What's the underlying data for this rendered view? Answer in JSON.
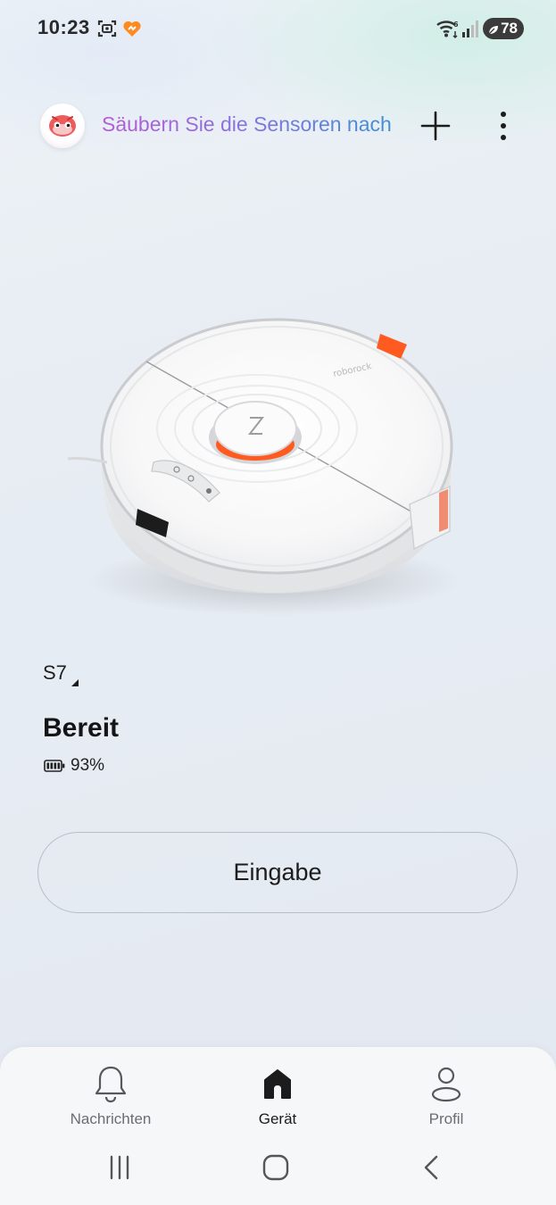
{
  "status_bar": {
    "time": "10:23",
    "battery": "78",
    "icons": [
      "screenshot-icon",
      "app-heart-icon",
      "wifi-icon",
      "signal-icon",
      "battery-saver-icon"
    ]
  },
  "header": {
    "mascot_icon": "mascot-avatar-icon",
    "announcement": "Säubern Sie die Sensoren nach",
    "add_icon": "plus-icon",
    "menu_icon": "more-vertical-icon"
  },
  "device": {
    "name": "S7",
    "status": "Bereit",
    "battery_percent": "93%",
    "image": "robot-vacuum-image"
  },
  "actions": {
    "enter_label": "Eingabe"
  },
  "bottom_nav": {
    "items": [
      {
        "label": "Nachrichten",
        "icon": "bell-icon",
        "active": false
      },
      {
        "label": "Gerät",
        "icon": "home-icon",
        "active": true
      },
      {
        "label": "Profil",
        "icon": "person-icon",
        "active": false
      }
    ]
  },
  "system_nav": {
    "icons": [
      "recent-apps-icon",
      "home-circle-icon",
      "back-icon"
    ]
  },
  "colors": {
    "accent_orange": "#ff5a1f",
    "announcement_gradient": [
      "#b45bd8",
      "#3f8fd6"
    ]
  }
}
